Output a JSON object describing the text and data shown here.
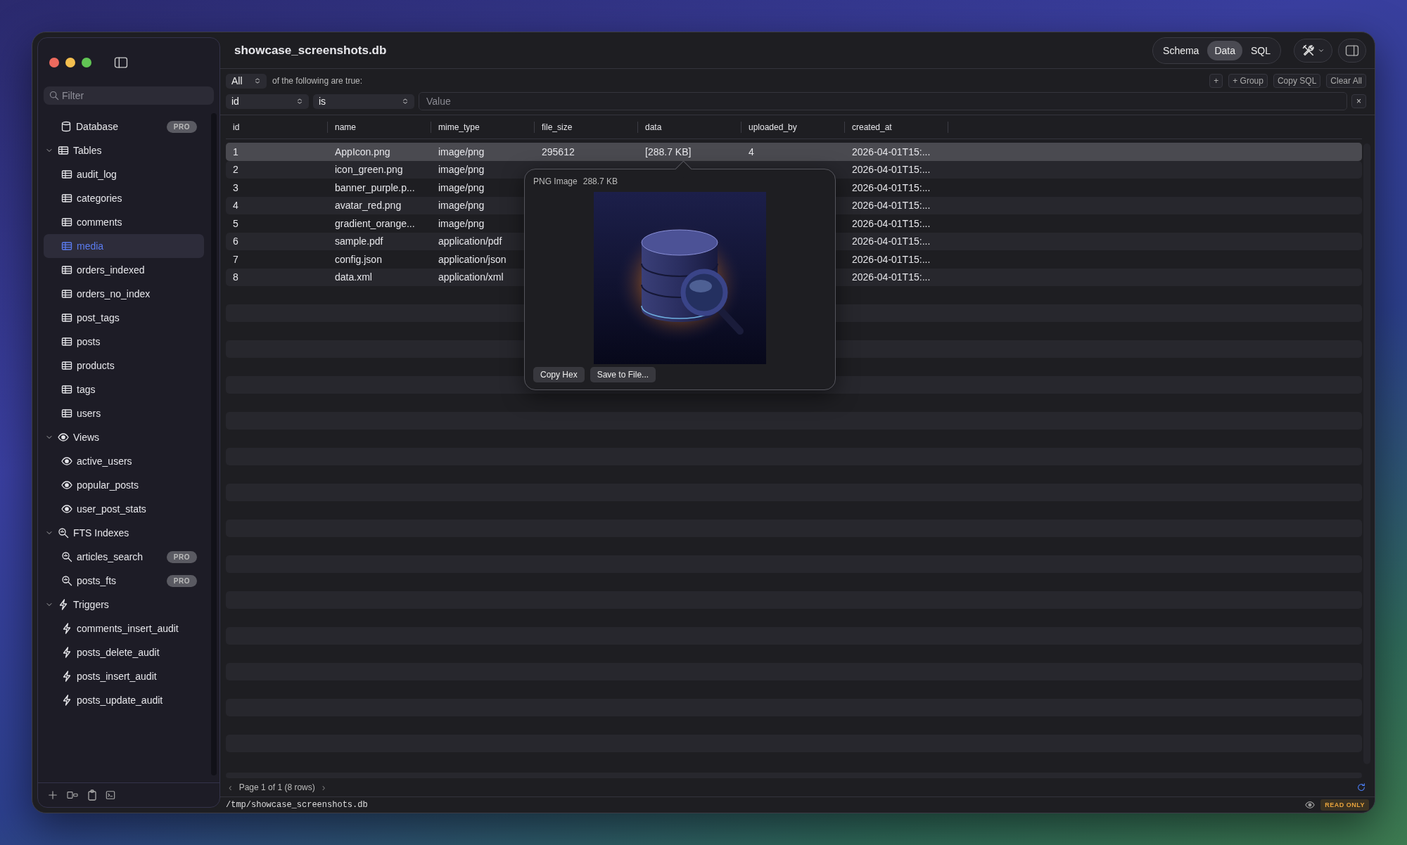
{
  "window": {
    "title": "showcase_screenshots.db"
  },
  "sidebar": {
    "filter": {
      "placeholder": "Filter"
    },
    "database": {
      "label": "Database",
      "badge": "PRO"
    },
    "groups": [
      {
        "kind": "tables",
        "label": "Tables",
        "expanded": true,
        "children": [
          {
            "label": "audit_log",
            "selected": false
          },
          {
            "label": "categories",
            "selected": false
          },
          {
            "label": "comments",
            "selected": false
          },
          {
            "label": "media",
            "selected": true
          },
          {
            "label": "orders_indexed",
            "selected": false
          },
          {
            "label": "orders_no_index",
            "selected": false
          },
          {
            "label": "post_tags",
            "selected": false
          },
          {
            "label": "posts",
            "selected": false
          },
          {
            "label": "products",
            "selected": false
          },
          {
            "label": "tags",
            "selected": false
          },
          {
            "label": "users",
            "selected": false
          }
        ]
      },
      {
        "kind": "views",
        "label": "Views",
        "expanded": true,
        "children": [
          {
            "label": "active_users",
            "selected": false
          },
          {
            "label": "popular_posts",
            "selected": false
          },
          {
            "label": "user_post_stats",
            "selected": false
          }
        ]
      },
      {
        "kind": "fts",
        "label": "FTS Indexes",
        "expanded": true,
        "children": [
          {
            "label": "articles_search",
            "selected": false,
            "badge": "PRO"
          },
          {
            "label": "posts_fts",
            "selected": false,
            "badge": "PRO"
          }
        ]
      },
      {
        "kind": "triggers",
        "label": "Triggers",
        "expanded": true,
        "children": [
          {
            "label": "comments_insert_audit",
            "selected": false
          },
          {
            "label": "posts_delete_audit",
            "selected": false
          },
          {
            "label": "posts_insert_audit",
            "selected": false
          },
          {
            "label": "posts_update_audit",
            "selected": false
          }
        ]
      }
    ]
  },
  "view_switch": [
    {
      "label": "Schema",
      "selected": false
    },
    {
      "label": "Data",
      "selected": true
    },
    {
      "label": "SQL",
      "selected": false
    }
  ],
  "filter_bar": {
    "match": "All",
    "match_text": "of the following are true:",
    "actions": [
      "+",
      "+ Group",
      "Copy SQL",
      "Clear All"
    ],
    "column": "id",
    "operator": "is",
    "value": {
      "placeholder": "Value"
    },
    "remove": "×"
  },
  "table": {
    "columns": [
      "id",
      "name",
      "mime_type",
      "file_size",
      "data",
      "uploaded_by",
      "created_at"
    ],
    "rows": [
      {
        "selected": true,
        "cells": [
          "1",
          "AppIcon.png",
          "image/png",
          "295612",
          "[288.7 KB]",
          "4",
          "2026-04-01T15:..."
        ]
      },
      {
        "selected": false,
        "cells": [
          "2",
          "icon_green.png",
          "image/png",
          null,
          null,
          null,
          "2026-04-01T15:..."
        ]
      },
      {
        "selected": false,
        "cells": [
          "3",
          "banner_purple.p...",
          "image/png",
          null,
          null,
          null,
          "2026-04-01T15:..."
        ]
      },
      {
        "selected": false,
        "cells": [
          "4",
          "avatar_red.png",
          "image/png",
          null,
          null,
          null,
          "2026-04-01T15:..."
        ]
      },
      {
        "selected": false,
        "cells": [
          "5",
          "gradient_orange...",
          "image/png",
          null,
          null,
          null,
          "2026-04-01T15:..."
        ]
      },
      {
        "selected": false,
        "cells": [
          "6",
          "sample.pdf",
          "application/pdf",
          null,
          null,
          null,
          "2026-04-01T15:..."
        ]
      },
      {
        "selected": false,
        "cells": [
          "7",
          "config.json",
          "application/json",
          null,
          null,
          null,
          "2026-04-01T15:..."
        ]
      },
      {
        "selected": false,
        "cells": [
          "8",
          "data.xml",
          "application/xml",
          null,
          null,
          null,
          "2026-04-01T15:..."
        ]
      }
    ]
  },
  "popover": {
    "title": "PNG Image",
    "size": "288.7 KB",
    "buttons": [
      "Copy Hex",
      "Save to File..."
    ]
  },
  "pagination": {
    "prev": "‹",
    "label": "Page 1 of 1 (8 rows)",
    "next": "›"
  },
  "status_bar": {
    "path": "/tmp/showcase_screenshots.db",
    "badge": "READ ONLY"
  }
}
